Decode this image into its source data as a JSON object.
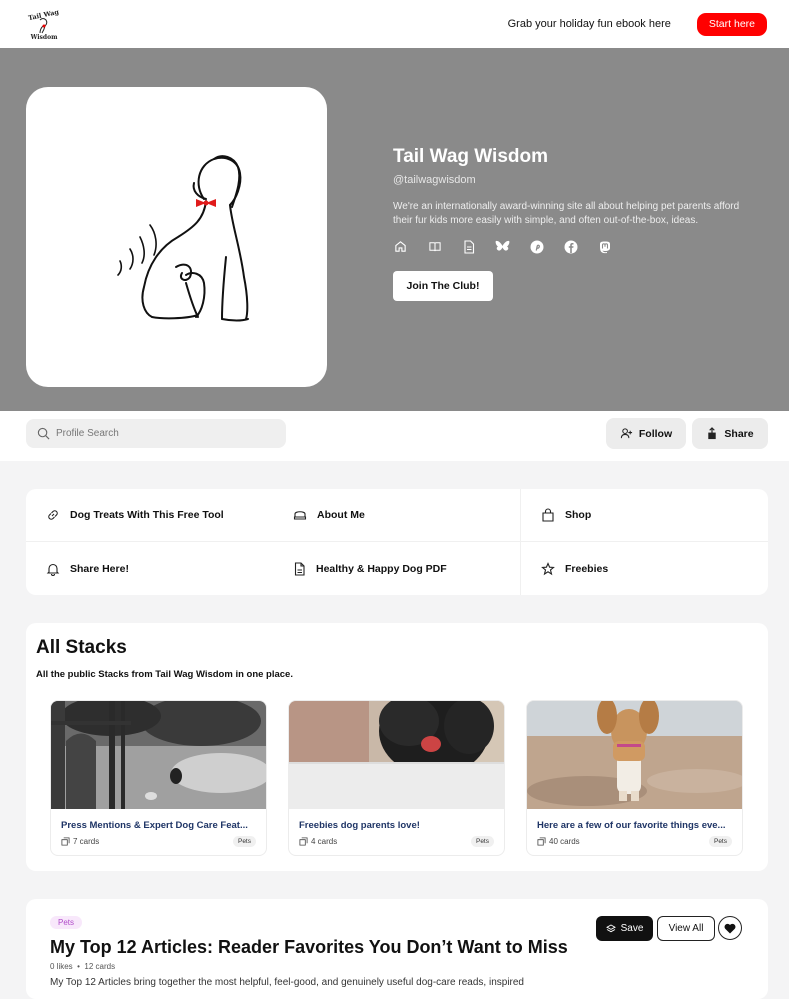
{
  "topbar": {
    "logo_text_top": "Tail Wag",
    "logo_text_bottom": "Wisdom",
    "promo": "Grab your holiday fun ebook here",
    "start_label": "Start here"
  },
  "hero": {
    "title": "Tail Wag Wisdom",
    "handle": "@tailwagwisdom",
    "description": "We're an internationally award-winning site all about helping pet parents afford their fur kids more easily with simple, and often out-of-the-box, ideas.",
    "social": [
      "home-icon",
      "book-icon",
      "document-icon",
      "bluesky-icon",
      "pinterest-icon",
      "facebook-icon",
      "mastodon-icon"
    ],
    "join_label": "Join The Club!"
  },
  "toolbar": {
    "search_placeholder": "Profile Search",
    "follow_label": "Follow",
    "share_label": "Share"
  },
  "links": [
    {
      "label": "Dog Treats With This Free Tool",
      "icon": "link-icon"
    },
    {
      "label": "About Me",
      "icon": "hat-icon"
    },
    {
      "label": "Shop",
      "icon": "shopping-bag-icon"
    },
    {
      "label": "Share Here!",
      "icon": "bell-icon"
    },
    {
      "label": "Healthy & Happy Dog PDF",
      "icon": "file-icon"
    },
    {
      "label": "Freebies",
      "icon": "star-icon"
    }
  ],
  "stacks": {
    "title": "All Stacks",
    "subtitle": "All the public Stacks from Tail Wag Wisdom in one place.",
    "items": [
      {
        "title": "Press Mentions & Expert Dog Care Feat...",
        "count": "7 cards",
        "tag": "Pets"
      },
      {
        "title": "Freebies dog parents love!",
        "count": "4 cards",
        "tag": "Pets"
      },
      {
        "title": "Here are a few of our favorite things eve...",
        "count": "40 cards",
        "tag": "Pets"
      }
    ]
  },
  "article": {
    "tag": "Pets",
    "title": "My Top 12 Articles: Reader Favorites You Don’t Want to Miss",
    "likes": "0 likes",
    "cards": "12 cards",
    "description": "My Top 12 Articles bring together the most helpful, feel-good, and genuinely useful dog-care reads, inspired",
    "save_label": "Save",
    "viewall_label": "View All"
  },
  "colors": {
    "accent_red": "#ff0000",
    "hero_bg": "#8a8a8a",
    "stack_title": "#1f3566",
    "tag_purple": "#b04bc9"
  }
}
